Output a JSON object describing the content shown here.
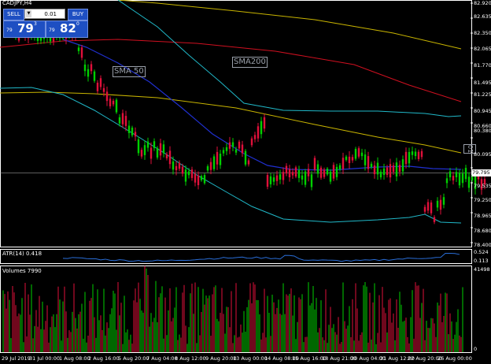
{
  "chart": {
    "title": "CADJPY,H4"
  },
  "trade_panel": {
    "sell_label": "SELL",
    "buy_label": "BUY",
    "lot_value": "0.01",
    "sell_quote_small": "79",
    "sell_quote_big": "79",
    "sell_quote_pip": "3",
    "buy_quote_small": "79",
    "buy_quote_big": "82",
    "buy_quote_pip": "0"
  },
  "annotations": {
    "sma50": "SMA 50",
    "sma200": "SMA200",
    "side_label": "01"
  },
  "price_axis": {
    "ticks": [
      "82.920",
      "82.635",
      "82.350",
      "82.065",
      "81.770",
      "81.495",
      "81.225",
      "80.945",
      "80.660",
      "80.380",
      "80.095",
      "79.795",
      "79.535",
      "79.250",
      "78.965",
      "78.680",
      "78.400"
    ],
    "current_price": "79.795"
  },
  "atr": {
    "label": "ATR(14) 0.418",
    "ticks": [
      "0.524",
      "0.113"
    ]
  },
  "volumes": {
    "label": "Volumes 7990",
    "ticks": [
      "41498",
      "0"
    ]
  },
  "time_axis": {
    "ticks": [
      "29 Jul 2019",
      "31 Jul 00:00",
      "1 Aug 08:00",
      "2 Aug 16:00",
      "5 Aug 20:00",
      "7 Aug 04:00",
      "8 Aug 12:00",
      "9 Aug 20:00",
      "13 Aug 00:00",
      "14 Aug 08:00",
      "15 Aug 16:00",
      "18 Aug 21:00",
      "20 Aug 04:00",
      "21 Aug 12:00",
      "22 Aug 20:00",
      "26 Aug 00:00"
    ]
  },
  "colors": {
    "bull": "#00d000",
    "bear": "#e0103a",
    "sma50": "#2030d0",
    "sma200": "#d01020",
    "ma_yellow": "#c8b400",
    "envelope": "#20b8c8",
    "atr_line": "#2a6ed8"
  }
}
